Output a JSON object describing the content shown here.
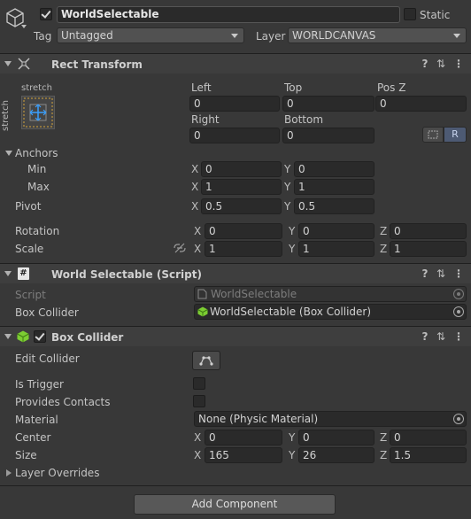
{
  "header": {
    "object_name": "WorldSelectable",
    "static_label": "Static",
    "tag_label": "Tag",
    "tag_value": "Untagged",
    "layer_label": "Layer",
    "layer_value": "WORLDCANVAS"
  },
  "rect_transform": {
    "title": "Rect Transform",
    "preset_top_label": "stretch",
    "preset_side_label": "stretch",
    "left_label": "Left",
    "left_value": "0",
    "top_label": "Top",
    "top_value": "0",
    "posz_label": "Pos Z",
    "posz_value": "0",
    "right_label": "Right",
    "right_value": "0",
    "bottom_label": "Bottom",
    "bottom_value": "0",
    "r_button": "R",
    "anchors_label": "Anchors",
    "min_label": "Min",
    "min_x": "0",
    "min_y": "0",
    "max_label": "Max",
    "max_x": "1",
    "max_y": "1",
    "pivot_label": "Pivot",
    "pivot_x": "0.5",
    "pivot_y": "0.5",
    "rotation_label": "Rotation",
    "rotation_x": "0",
    "rotation_y": "0",
    "rotation_z": "0",
    "scale_label": "Scale",
    "scale_x": "1",
    "scale_y": "1",
    "scale_z": "1"
  },
  "axes": {
    "x": "X",
    "y": "Y",
    "z": "Z"
  },
  "world_selectable": {
    "title": "World Selectable (Script)",
    "script_label": "Script",
    "script_value": "WorldSelectable",
    "box_collider_label": "Box Collider",
    "box_collider_value": "WorldSelectable (Box Collider)"
  },
  "box_collider": {
    "title": "Box Collider",
    "edit_collider_label": "Edit Collider",
    "is_trigger_label": "Is Trigger",
    "provides_contacts_label": "Provides Contacts",
    "material_label": "Material",
    "material_value": "None (Physic Material)",
    "center_label": "Center",
    "center_x": "0",
    "center_y": "0",
    "center_z": "0",
    "size_label": "Size",
    "size_x": "165",
    "size_y": "26",
    "size_z": "1.5",
    "layer_overrides_label": "Layer Overrides"
  },
  "footer": {
    "add_component_label": "Add Component"
  },
  "colors": {
    "background": "#383838",
    "header_background": "#3e3e3e",
    "field_background": "#2a2a2a",
    "anchor_accent": "#d4a23a",
    "anchor_arrow": "#3aa0ff",
    "collider_icon": "#7ccd32"
  }
}
